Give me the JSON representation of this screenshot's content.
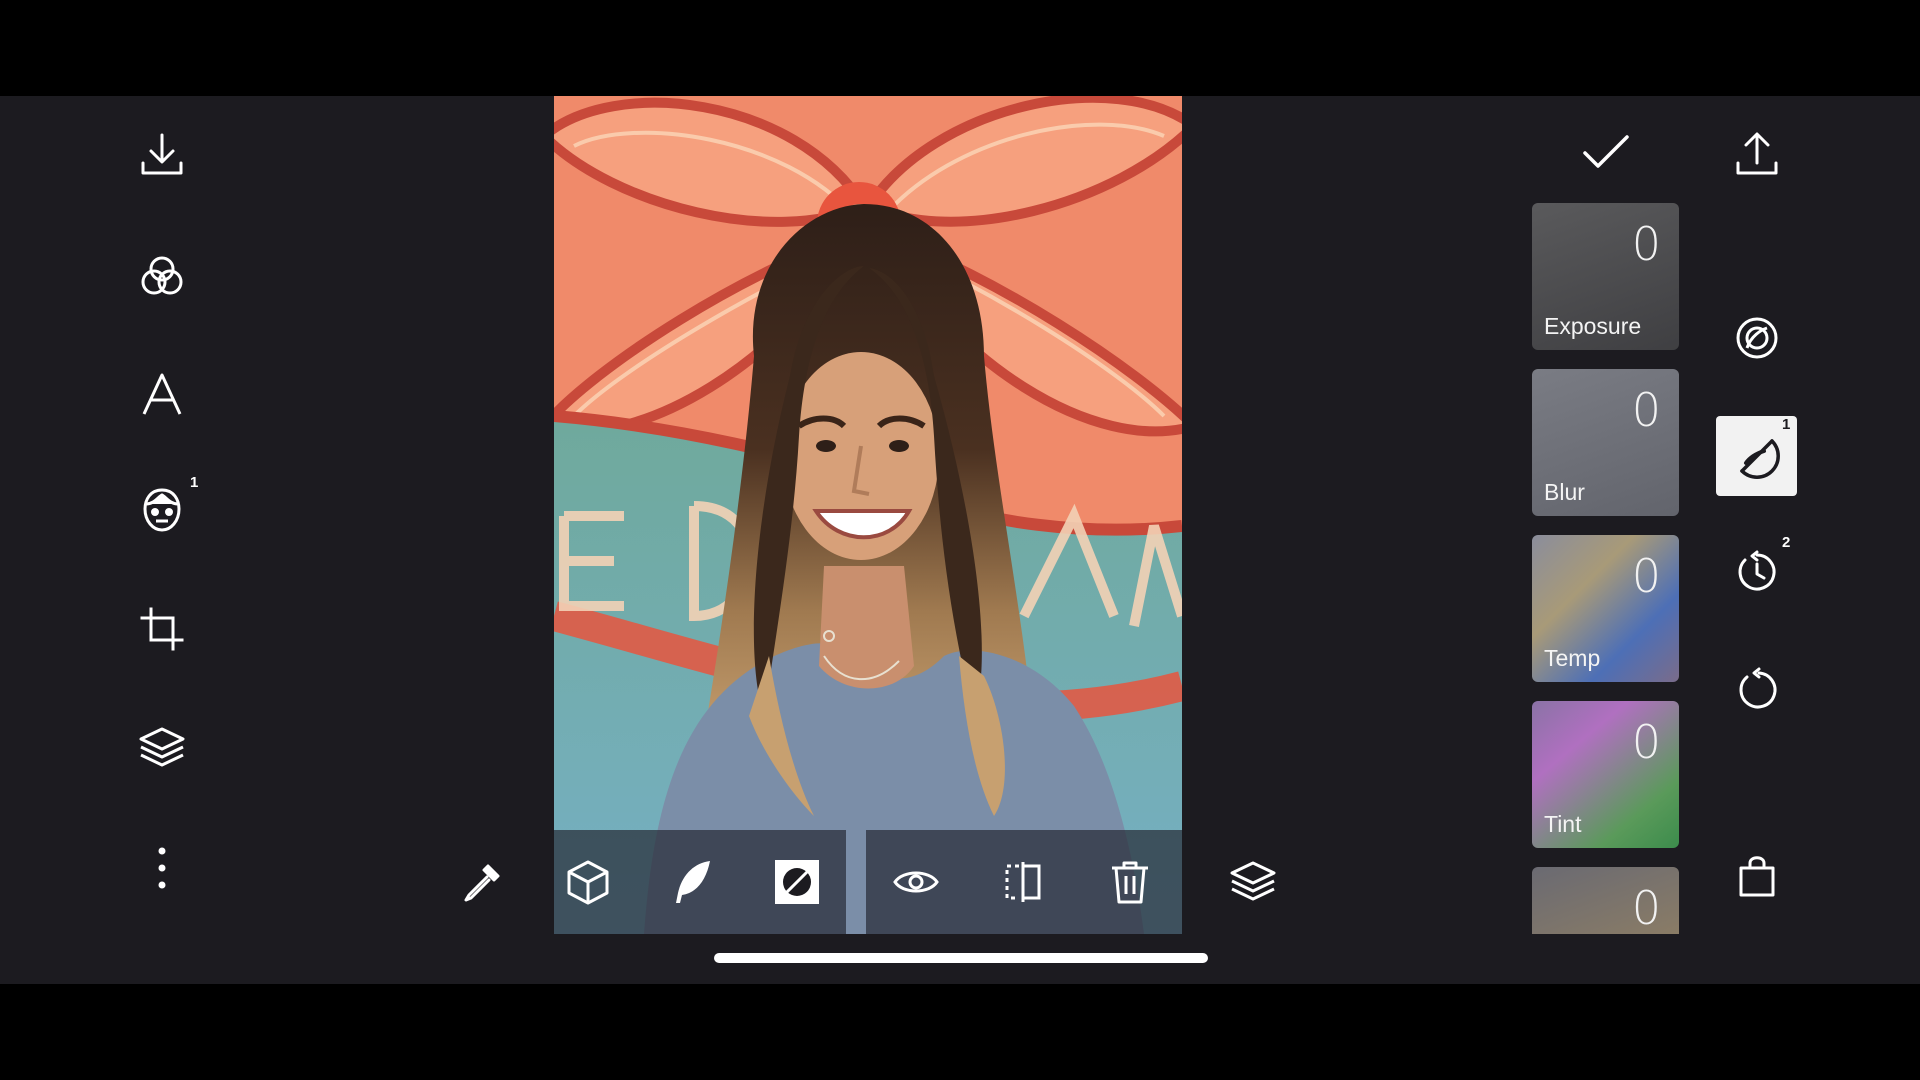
{
  "left_toolbar": {
    "items": [
      {
        "icon": "download-icon"
      },
      {
        "icon": "filters-icon"
      },
      {
        "icon": "text-icon"
      },
      {
        "icon": "face-icon",
        "badge": "1"
      },
      {
        "icon": "crop-icon"
      },
      {
        "icon": "layers-icon"
      },
      {
        "icon": "more-icon"
      }
    ]
  },
  "bottom_toolbar": {
    "items": [
      {
        "icon": "eyedropper-icon"
      },
      {
        "icon": "cube-icon"
      },
      {
        "icon": "feather-icon"
      },
      {
        "icon": "mask-icon"
      },
      {
        "icon": "eye-icon"
      },
      {
        "icon": "split-icon"
      },
      {
        "icon": "trash-icon"
      },
      {
        "icon": "layers-icon"
      }
    ]
  },
  "right_toolbar": {
    "confirm_icon": "checkmark-icon",
    "share_icon": "share-icon",
    "items": [
      {
        "icon": "lens-icon"
      },
      {
        "icon": "brush-mask-icon",
        "badge": "1",
        "active": true
      },
      {
        "icon": "history-icon",
        "badge": "2"
      },
      {
        "icon": "reset-icon"
      },
      {
        "icon": "bag-icon"
      }
    ]
  },
  "adjustments": [
    {
      "label": "Exposure",
      "value": "0"
    },
    {
      "label": "Blur",
      "value": "0"
    },
    {
      "label": "Temp",
      "value": "0"
    },
    {
      "label": "Tint",
      "value": "0"
    },
    {
      "label": "",
      "value": "0"
    }
  ],
  "colors": {
    "app_background": "#1c1b20",
    "wall": "#f08a6a",
    "banner": "#6fa99c",
    "shirt": "#7b8ea8"
  }
}
